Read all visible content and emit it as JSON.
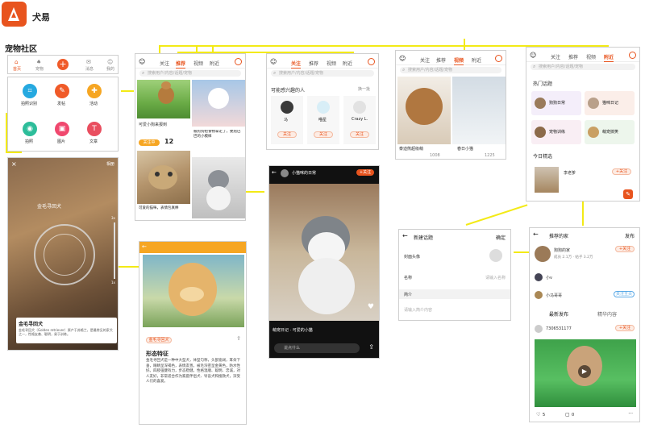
{
  "app": {
    "name": "犬易",
    "section_title": "宠物社区"
  },
  "bottom_nav": [
    "首页",
    "宠物",
    "",
    "消息",
    "我的"
  ],
  "publish_menu": {
    "items": [
      {
        "label": "拍照识别",
        "color": "#26a9e0",
        "icon": "scan-icon"
      },
      {
        "label": "发帖",
        "color": "#f05a28",
        "icon": "pen-icon"
      },
      {
        "label": "活动",
        "color": "#f6a623",
        "icon": "gift-icon"
      },
      {
        "label": "拍照",
        "color": "#2dbd9a",
        "icon": "camera-icon"
      },
      {
        "label": "图片",
        "color": "#f0486e",
        "icon": "image-icon"
      },
      {
        "label": "文章",
        "color": "#e94e5f",
        "icon": "text-icon"
      }
    ]
  },
  "camera": {
    "album": "相册",
    "detected": "金毛寻回犬",
    "zoom_top": "3x",
    "zoom_bottom": "1x",
    "card_title": "金毛寻回犬",
    "card_desc": "金毛寻回犬（Golden retriever）原产于苏格兰，是最常见的家犬之一，性格友善、聪明，易于训练。"
  },
  "recommend": {
    "tabs": [
      "关注",
      "推荐",
      "视频",
      "附近"
    ],
    "search": "搜索用户/内容/话题/宠物",
    "post1_title": "可爱小狗来报到",
    "post1_tag": "关注中",
    "post1_count": "12",
    "post2_title": "被狗狗把食物拿走了，委屈巴巴的小模样",
    "post3_title": "可爱的猫咪，表情包真棒",
    "post4_title": ""
  },
  "follow": {
    "tabs": [
      "关注",
      "推荐",
      "视频",
      "附近"
    ],
    "search": "搜索用户/内容/话题/宠物",
    "section": "可能感兴趣的人",
    "refresh": "换一批",
    "users": [
      {
        "name": "马",
        "btn": "关注"
      },
      {
        "name": "喵星",
        "btn": "关注"
      },
      {
        "name": "Crazy L.",
        "btn": "关注"
      }
    ]
  },
  "video_feed": {
    "tabs": [
      "关注",
      "推荐",
      "视频",
      "附近"
    ],
    "search": "搜索用户/内容/话题/宠物",
    "v1_title": "泰迪熊超级萌",
    "v1_meta": "1008",
    "v2_title": "春日小猫",
    "v2_meta": "1225"
  },
  "video_play": {
    "user": "小猫咪的日常",
    "follow": "+关注",
    "tag": "萌宠日记 · 可爱的小猫",
    "comment_placeholder": "说点什么"
  },
  "nearby": {
    "tabs": [
      "关注",
      "推荐",
      "视频",
      "附近"
    ],
    "search": "搜索用户/内容/话题/宠物",
    "hot_title": "热门话题",
    "topics": [
      "狗狗日常",
      "猫咪日记",
      "宠物训练",
      "萌宠搞笑"
    ],
    "feeds_title": "今日精选",
    "feed_user": "李老爹",
    "feed_btn": "+关注"
  },
  "article": {
    "tag": "金毛寻回犬",
    "title": "形态特征",
    "body": "金毛寻回犬是一种中大型犬，体型匀称，头部宽阔，耳朵下垂，眼睛呈深褐色，表情友善。被毛浓密呈金黄色，防水性好。四肢强健有力，步态稳健。性格温顺、聪明、忠诚，对人友好，非常适合作为家庭伴侣犬、导盲犬和搜救犬，深受人们的喜爱。"
  },
  "new_topic": {
    "title": "新建话题",
    "save": "确定",
    "rows": [
      {
        "label": "封面头像",
        "value": ""
      },
      {
        "label": "名称",
        "value": "请输入名称"
      },
      {
        "label": "简介",
        "value": ""
      }
    ],
    "placeholder": "请输入简介内容"
  },
  "topic_detail": {
    "title": "推荐的家",
    "publish": "发布",
    "owner": "狗狗的家",
    "owner_sub": "成员 2.1万 · 帖子 3.2万",
    "owner_btn": "+关注",
    "members": [
      {
        "name": "小v",
        "btn": ""
      },
      {
        "name": "小马哥哥",
        "btn": "关注主页"
      }
    ],
    "tabs": [
      "最新发布",
      "精华内容"
    ],
    "post_user": "7306531177",
    "post_btn": "+关注",
    "likes": "5",
    "comments": "0"
  }
}
